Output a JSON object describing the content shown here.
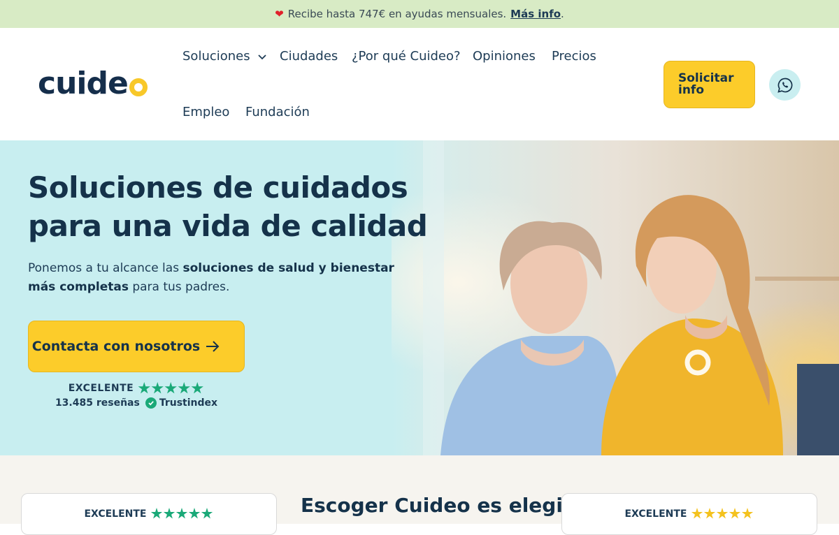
{
  "topbar": {
    "message": "Recibe hasta 747€ en ayudas mensuales.",
    "link": "Más info",
    "after": "."
  },
  "header": {
    "logo": "cuide",
    "nav": [
      {
        "label": "Soluciones",
        "has_dropdown": true
      },
      {
        "label": "Ciudades"
      },
      {
        "label": "¿Por qué Cuideo?"
      },
      {
        "label": "Opiniones"
      },
      {
        "label": "Precios"
      },
      {
        "label": "Empleo"
      },
      {
        "label": "Fundación"
      }
    ],
    "cta": "Solicitar info",
    "whatsapp_icon": "whatsapp-icon"
  },
  "hero": {
    "title": "Soluciones de cuidados para una vida de calidad",
    "subtitle_parts": [
      "Ponemos a tu alcance las ",
      "soluciones de salud y bienestar más completas",
      " para tus padres."
    ],
    "cta": "Contacta con nosotros",
    "rating_label": "EXCELENTE",
    "reviews": "13.485 reseñas",
    "source": "Trustindex"
  },
  "section2": {
    "title": "Escoger Cuideo es elegir",
    "card_left": {
      "rating_label": "EXCELENTE",
      "star_color": "#1aa978"
    },
    "card_right": {
      "rating_label": "EXCELENTE",
      "star_color": "#f4c21e"
    }
  },
  "colors": {
    "brand_navy": "#15324a",
    "brand_yellow": "#fccc2a",
    "hero_bg": "#c8eef0",
    "topbar_bg": "#d8ebc5"
  }
}
